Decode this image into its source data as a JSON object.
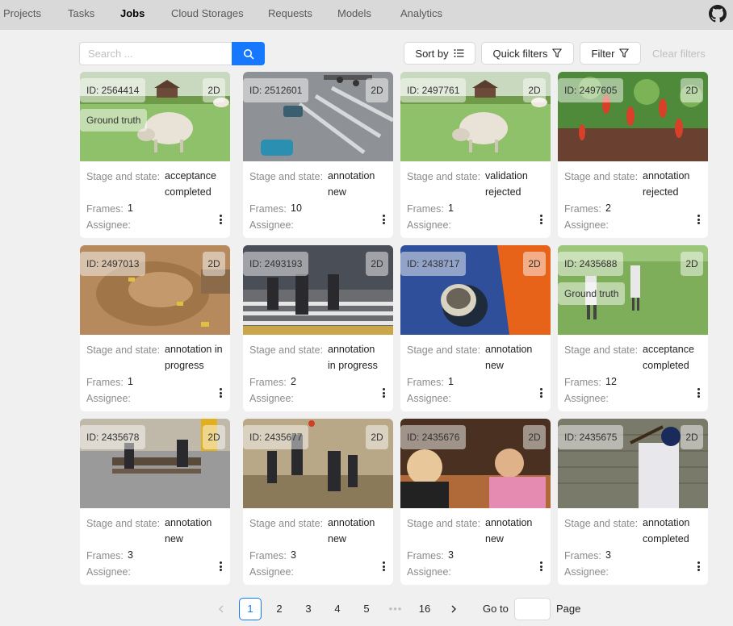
{
  "nav": {
    "items": [
      "Projects",
      "Tasks",
      "Jobs",
      "Cloud Storages",
      "Requests",
      "Models",
      "Analytics"
    ],
    "active": "Jobs",
    "github_icon": "github-icon"
  },
  "toolbar": {
    "search_placeholder": "Search ...",
    "search_icon": "search-icon",
    "sort_label": "Sort by",
    "quick_filters_label": "Quick filters",
    "filter_label": "Filter",
    "clear_filters_label": "Clear filters"
  },
  "labels": {
    "stage_state": "Stage and state:",
    "frames": "Frames:",
    "assignee": "Assignee:",
    "ground_truth": "Ground truth"
  },
  "jobs": [
    {
      "id": "ID: 2564414",
      "dim": "2D",
      "stage": "acceptance",
      "state": "completed",
      "frames": "1",
      "ground_truth": true
    },
    {
      "id": "ID: 2512601",
      "dim": "2D",
      "stage": "annotation",
      "state": "new",
      "frames": "10",
      "ground_truth": false
    },
    {
      "id": "ID: 2497761",
      "dim": "2D",
      "stage": "validation",
      "state": "rejected",
      "frames": "1",
      "ground_truth": false
    },
    {
      "id": "ID: 2497605",
      "dim": "2D",
      "stage": "annotation",
      "state": "rejected",
      "frames": "2",
      "ground_truth": false
    },
    {
      "id": "ID: 2497013",
      "dim": "2D",
      "stage": "annotation in",
      "state": "progress",
      "frames": "1",
      "ground_truth": false
    },
    {
      "id": "ID: 2493193",
      "dim": "2D",
      "stage": "annotation",
      "state": "in progress",
      "frames": "2",
      "ground_truth": false
    },
    {
      "id": "ID: 2438717",
      "dim": "2D",
      "stage": "annotation",
      "state": "new",
      "frames": "1",
      "ground_truth": false
    },
    {
      "id": "ID: 2435688",
      "dim": "2D",
      "stage": "acceptance",
      "state": "completed",
      "frames": "12",
      "ground_truth": true
    },
    {
      "id": "ID: 2435678",
      "dim": "2D",
      "stage": "annotation",
      "state": "new",
      "frames": "3",
      "ground_truth": false
    },
    {
      "id": "ID: 2435677",
      "dim": "2D",
      "stage": "annotation",
      "state": "new",
      "frames": "3",
      "ground_truth": false
    },
    {
      "id": "ID: 2435676",
      "dim": "2D",
      "stage": "annotation",
      "state": "new",
      "frames": "3",
      "ground_truth": false
    },
    {
      "id": "ID: 2435675",
      "dim": "2D",
      "stage": "annotation",
      "state": "completed",
      "frames": "3",
      "ground_truth": false
    }
  ],
  "pagination": {
    "pages": [
      "1",
      "2",
      "3",
      "4",
      "5"
    ],
    "current": "1",
    "ellipsis": "•••",
    "last": "16",
    "goto_label": "Go to",
    "page_label": "Page"
  },
  "colors": {
    "primary": "#1677ff",
    "header_bg": "#d9d9d9",
    "page_bg": "#f0f0f0"
  }
}
